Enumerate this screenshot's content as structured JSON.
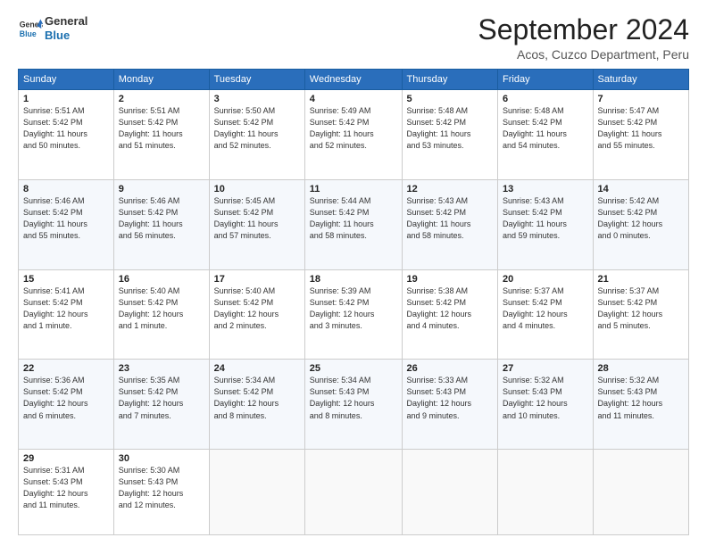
{
  "logo": {
    "line1": "General",
    "line2": "Blue"
  },
  "title": "September 2024",
  "subtitle": "Acos, Cuzco Department, Peru",
  "days_header": [
    "Sunday",
    "Monday",
    "Tuesday",
    "Wednesday",
    "Thursday",
    "Friday",
    "Saturday"
  ],
  "weeks": [
    [
      {
        "day": "1",
        "info": "Sunrise: 5:51 AM\nSunset: 5:42 PM\nDaylight: 11 hours\nand 50 minutes."
      },
      {
        "day": "2",
        "info": "Sunrise: 5:51 AM\nSunset: 5:42 PM\nDaylight: 11 hours\nand 51 minutes."
      },
      {
        "day": "3",
        "info": "Sunrise: 5:50 AM\nSunset: 5:42 PM\nDaylight: 11 hours\nand 52 minutes."
      },
      {
        "day": "4",
        "info": "Sunrise: 5:49 AM\nSunset: 5:42 PM\nDaylight: 11 hours\nand 52 minutes."
      },
      {
        "day": "5",
        "info": "Sunrise: 5:48 AM\nSunset: 5:42 PM\nDaylight: 11 hours\nand 53 minutes."
      },
      {
        "day": "6",
        "info": "Sunrise: 5:48 AM\nSunset: 5:42 PM\nDaylight: 11 hours\nand 54 minutes."
      },
      {
        "day": "7",
        "info": "Sunrise: 5:47 AM\nSunset: 5:42 PM\nDaylight: 11 hours\nand 55 minutes."
      }
    ],
    [
      {
        "day": "8",
        "info": "Sunrise: 5:46 AM\nSunset: 5:42 PM\nDaylight: 11 hours\nand 55 minutes."
      },
      {
        "day": "9",
        "info": "Sunrise: 5:46 AM\nSunset: 5:42 PM\nDaylight: 11 hours\nand 56 minutes."
      },
      {
        "day": "10",
        "info": "Sunrise: 5:45 AM\nSunset: 5:42 PM\nDaylight: 11 hours\nand 57 minutes."
      },
      {
        "day": "11",
        "info": "Sunrise: 5:44 AM\nSunset: 5:42 PM\nDaylight: 11 hours\nand 58 minutes."
      },
      {
        "day": "12",
        "info": "Sunrise: 5:43 AM\nSunset: 5:42 PM\nDaylight: 11 hours\nand 58 minutes."
      },
      {
        "day": "13",
        "info": "Sunrise: 5:43 AM\nSunset: 5:42 PM\nDaylight: 11 hours\nand 59 minutes."
      },
      {
        "day": "14",
        "info": "Sunrise: 5:42 AM\nSunset: 5:42 PM\nDaylight: 12 hours\nand 0 minutes."
      }
    ],
    [
      {
        "day": "15",
        "info": "Sunrise: 5:41 AM\nSunset: 5:42 PM\nDaylight: 12 hours\nand 1 minute."
      },
      {
        "day": "16",
        "info": "Sunrise: 5:40 AM\nSunset: 5:42 PM\nDaylight: 12 hours\nand 1 minute."
      },
      {
        "day": "17",
        "info": "Sunrise: 5:40 AM\nSunset: 5:42 PM\nDaylight: 12 hours\nand 2 minutes."
      },
      {
        "day": "18",
        "info": "Sunrise: 5:39 AM\nSunset: 5:42 PM\nDaylight: 12 hours\nand 3 minutes."
      },
      {
        "day": "19",
        "info": "Sunrise: 5:38 AM\nSunset: 5:42 PM\nDaylight: 12 hours\nand 4 minutes."
      },
      {
        "day": "20",
        "info": "Sunrise: 5:37 AM\nSunset: 5:42 PM\nDaylight: 12 hours\nand 4 minutes."
      },
      {
        "day": "21",
        "info": "Sunrise: 5:37 AM\nSunset: 5:42 PM\nDaylight: 12 hours\nand 5 minutes."
      }
    ],
    [
      {
        "day": "22",
        "info": "Sunrise: 5:36 AM\nSunset: 5:42 PM\nDaylight: 12 hours\nand 6 minutes."
      },
      {
        "day": "23",
        "info": "Sunrise: 5:35 AM\nSunset: 5:42 PM\nDaylight: 12 hours\nand 7 minutes."
      },
      {
        "day": "24",
        "info": "Sunrise: 5:34 AM\nSunset: 5:42 PM\nDaylight: 12 hours\nand 8 minutes."
      },
      {
        "day": "25",
        "info": "Sunrise: 5:34 AM\nSunset: 5:43 PM\nDaylight: 12 hours\nand 8 minutes."
      },
      {
        "day": "26",
        "info": "Sunrise: 5:33 AM\nSunset: 5:43 PM\nDaylight: 12 hours\nand 9 minutes."
      },
      {
        "day": "27",
        "info": "Sunrise: 5:32 AM\nSunset: 5:43 PM\nDaylight: 12 hours\nand 10 minutes."
      },
      {
        "day": "28",
        "info": "Sunrise: 5:32 AM\nSunset: 5:43 PM\nDaylight: 12 hours\nand 11 minutes."
      }
    ],
    [
      {
        "day": "29",
        "info": "Sunrise: 5:31 AM\nSunset: 5:43 PM\nDaylight: 12 hours\nand 11 minutes."
      },
      {
        "day": "30",
        "info": "Sunrise: 5:30 AM\nSunset: 5:43 PM\nDaylight: 12 hours\nand 12 minutes."
      },
      null,
      null,
      null,
      null,
      null
    ]
  ]
}
